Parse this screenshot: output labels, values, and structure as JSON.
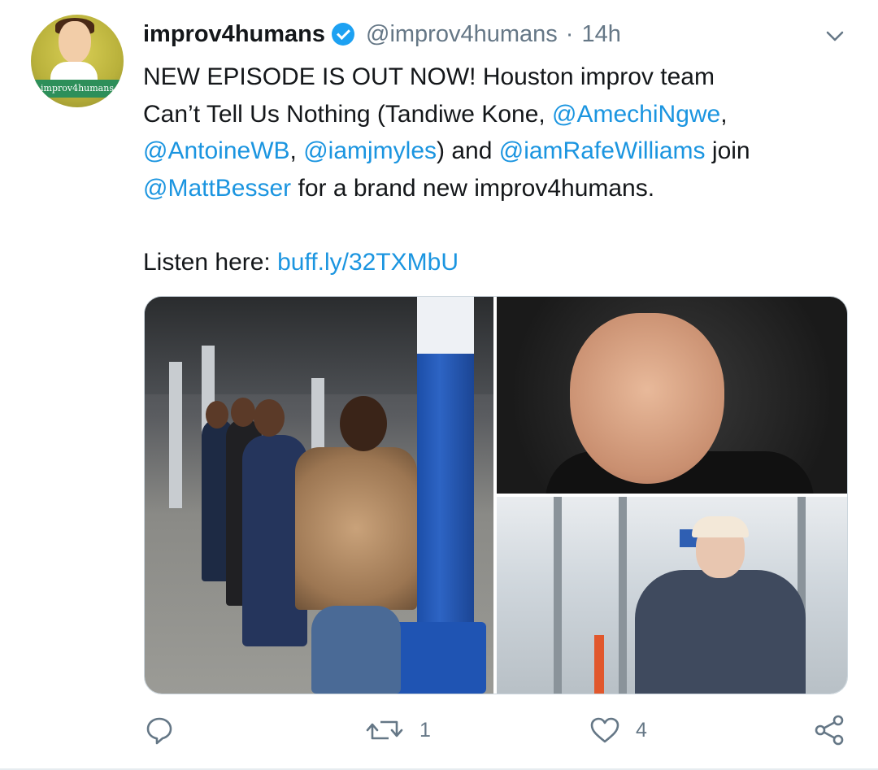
{
  "tweet": {
    "display_name": "improv4humans",
    "handle": "@improv4humans",
    "separator": "·",
    "time": "14h",
    "avatar_text": "improv4humans",
    "text_lines": [
      [
        {
          "t": "NEW EPISODE IS OUT NOW! Houston improv team"
        }
      ],
      [
        {
          "t": "Can’t Tell Us Nothing (Tandiwe Kone, "
        },
        {
          "t": "@AmechiNgwe",
          "m": 1
        },
        {
          "t": ","
        }
      ],
      [
        {
          "t": "@AntoineWB",
          "m": 1
        },
        {
          "t": ", "
        },
        {
          "t": "@iamjmyles",
          "m": 1
        },
        {
          "t": ") and "
        },
        {
          "t": "@iamRafeWilliams",
          "m": 1
        },
        {
          "t": " join"
        }
      ],
      [
        {
          "t": "@MattBesser",
          "m": 1
        },
        {
          "t": " for a brand new improv4humans."
        }
      ],
      [],
      [
        {
          "t": "Listen here: "
        },
        {
          "t": "buff.ly/32TXMbU",
          "m": 1
        }
      ]
    ]
  },
  "actions": {
    "reply_count": "",
    "retweet_count": "1",
    "like_count": "4"
  },
  "colors": {
    "link": "#1b95e0",
    "verified": "#1da1f2",
    "muted": "#657786"
  },
  "icons": [
    "verified-badge-icon",
    "chevron-down-icon",
    "reply-icon",
    "retweet-icon",
    "like-icon",
    "share-icon"
  ]
}
